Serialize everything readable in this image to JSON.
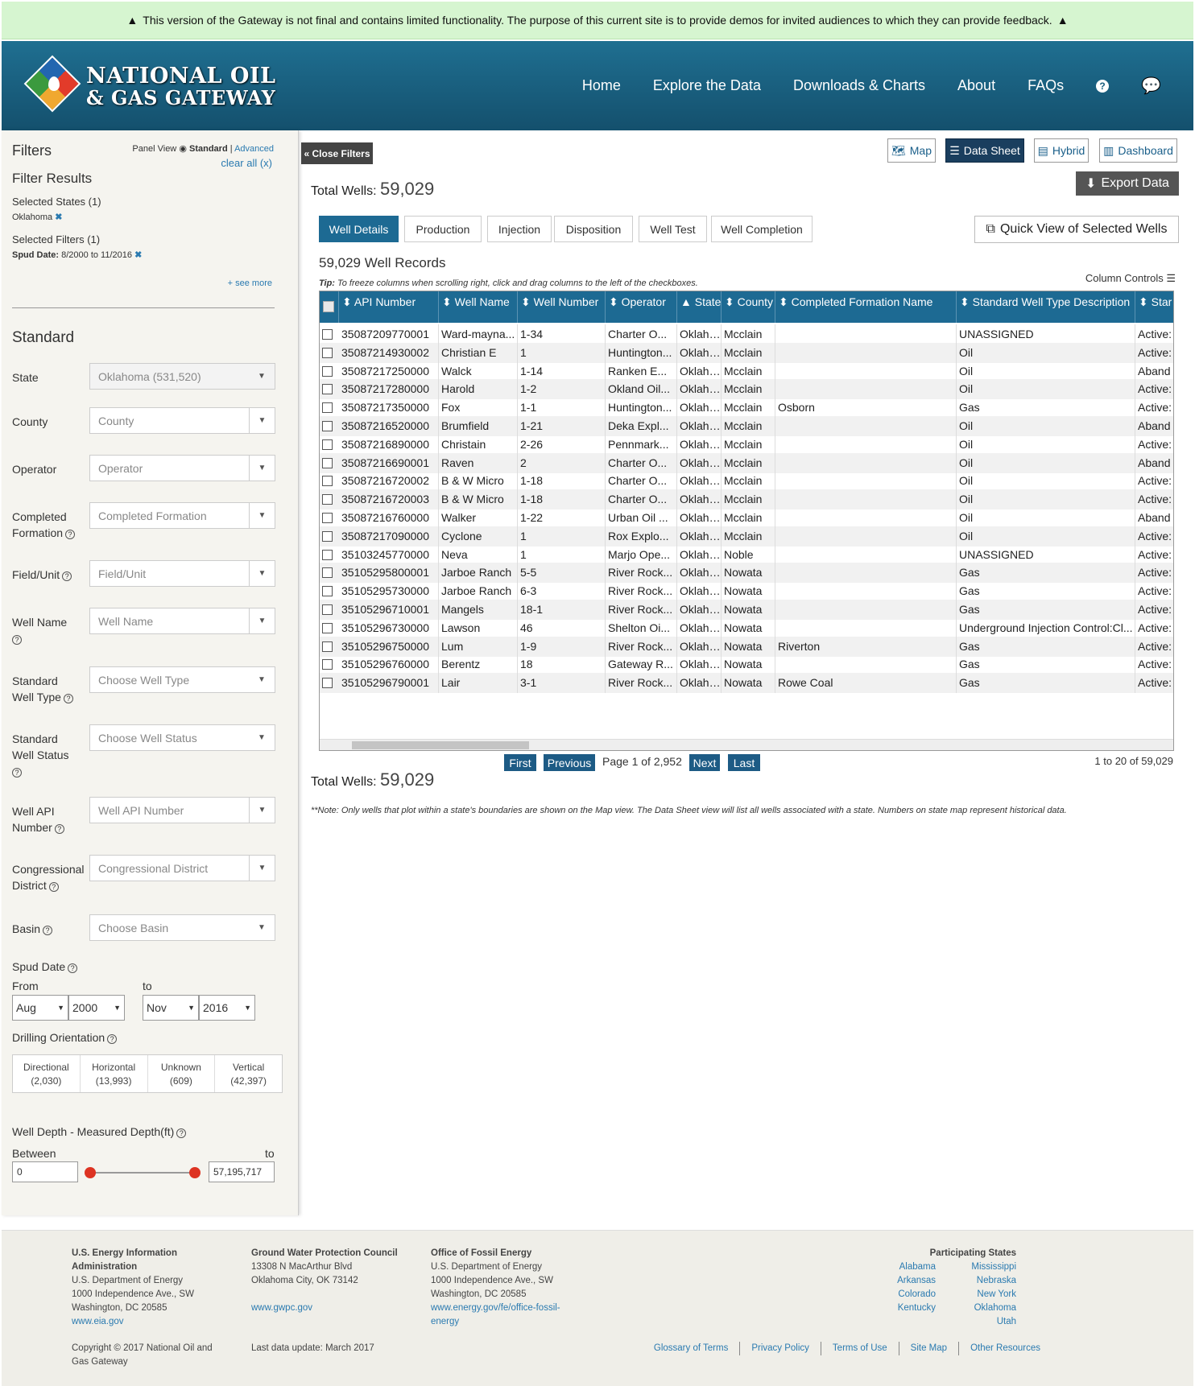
{
  "banner": {
    "text": "This version of the Gateway is not final and contains limited functionality. The purpose of this current site is to provide demos for invited audiences to which they can provide feedback."
  },
  "header": {
    "logo_line1": "NATIONAL OIL",
    "logo_line2": "& GAS GATEWAY",
    "nav": [
      "Home",
      "Explore the Data",
      "Downloads & Charts",
      "About",
      "FAQs"
    ]
  },
  "sidebar": {
    "filters_title": "Filters",
    "panel_view": "Panel View",
    "standard": "Standard",
    "advanced": "Advanced",
    "clear_all": "clear all (x)",
    "filter_results": "Filter Results",
    "selected_states": "Selected States (1)",
    "state_value": "Oklahoma",
    "selected_filters": "Selected Filters (1)",
    "spud_label": "Spud Date:",
    "spud_value": "8/2000 to 11/2016",
    "see_more": "+ see more",
    "standard_heading": "Standard",
    "fields": [
      {
        "label": "State",
        "value": "Oklahoma (531,520)"
      },
      {
        "label": "County",
        "value": "County"
      },
      {
        "label": "Operator",
        "value": "Operator"
      },
      {
        "label": "Completed Formation",
        "value": "Completed Formation"
      },
      {
        "label": "Field/Unit",
        "value": "Field/Unit"
      },
      {
        "label": "Well Name",
        "value": "Well Name"
      },
      {
        "label": "Standard Well Type",
        "value": "Choose Well Type"
      },
      {
        "label": "Standard Well Status",
        "value": "Choose Well Status"
      },
      {
        "label": "Well API Number",
        "value": "Well API Number"
      },
      {
        "label": "Congressional District",
        "value": "Congressional District"
      },
      {
        "label": "Basin",
        "value": "Choose Basin"
      }
    ],
    "spud_date": "Spud Date",
    "from": "From",
    "to": "to",
    "from_month": "Aug",
    "from_year": "2000",
    "to_month": "Nov",
    "to_year": "2016",
    "drilling_orientation": "Drilling Orientation",
    "orientations": [
      {
        "name": "Directional",
        "count": "(2,030)"
      },
      {
        "name": "Horizontal",
        "count": "(13,993)"
      },
      {
        "name": "Unknown",
        "count": "(609)"
      },
      {
        "name": "Vertical",
        "count": "(42,397)"
      }
    ],
    "well_depth": "Well Depth - Measured Depth(ft)",
    "between": "Between",
    "depth_to": "to",
    "depth_min": "0",
    "depth_max": "57,195,717"
  },
  "main": {
    "close_filters": "« Close Filters",
    "views": [
      "Map",
      "Data Sheet",
      "Hybrid",
      "Dashboard"
    ],
    "total_label": "Total Wells:",
    "total_value": "59,029",
    "export": "Export Data",
    "tabs": [
      "Well Details",
      "Production",
      "Injection",
      "Disposition",
      "Well Test",
      "Well Completion"
    ],
    "quick_view": "Quick View of Selected Wells",
    "records": "59,029 Well Records",
    "tip_label": "Tip:",
    "tip": "To freeze columns when scrolling right, click and drag columns to the left of the checkboxes.",
    "column_controls": "Column Controls",
    "columns": [
      "API Number",
      "Well Name",
      "Well Number",
      "Operator",
      "State",
      "County",
      "Completed Formation Name",
      "Standard Well Type Description",
      "Star"
    ],
    "rows": [
      [
        "35087209770001",
        "Ward-mayna...",
        "1-34",
        "Charter O...",
        "Oklaho...",
        "Mcclain",
        "",
        "UNASSIGNED",
        "Active:"
      ],
      [
        "35087214930002",
        "Christian E",
        "1",
        "Huntington...",
        "Oklaho...",
        "Mcclain",
        "",
        "Oil",
        "Active:"
      ],
      [
        "35087217250000",
        "Walck",
        "1-14",
        "Ranken E...",
        "Oklaho...",
        "Mcclain",
        "",
        "Oil",
        "Aband"
      ],
      [
        "35087217280000",
        "Harold",
        "1-2",
        "Okland Oil...",
        "Oklaho...",
        "Mcclain",
        "",
        "Oil",
        "Active:"
      ],
      [
        "35087217350000",
        "Fox",
        "1-1",
        "Huntington...",
        "Oklaho...",
        "Mcclain",
        "Osborn",
        "Gas",
        "Active:"
      ],
      [
        "35087216520000",
        "Brumfield",
        "1-21",
        "Deka Expl...",
        "Oklaho...",
        "Mcclain",
        "",
        "Oil",
        "Aband"
      ],
      [
        "35087216890000",
        "Christain",
        "2-26",
        "Pennmark...",
        "Oklaho...",
        "Mcclain",
        "",
        "Oil",
        "Active:"
      ],
      [
        "35087216690001",
        "Raven",
        "2",
        "Charter O...",
        "Oklaho...",
        "Mcclain",
        "",
        "Oil",
        "Aband"
      ],
      [
        "35087216720002",
        "B & W Micro",
        "1-18",
        "Charter O...",
        "Oklaho...",
        "Mcclain",
        "",
        "Oil",
        "Active:"
      ],
      [
        "35087216720003",
        "B & W Micro",
        "1-18",
        "Charter O...",
        "Oklaho...",
        "Mcclain",
        "",
        "Oil",
        "Active:"
      ],
      [
        "35087216760000",
        "Walker",
        "1-22",
        "Urban Oil ...",
        "Oklaho...",
        "Mcclain",
        "",
        "Oil",
        "Aband"
      ],
      [
        "35087217090000",
        "Cyclone",
        "1",
        "Rox Explo...",
        "Oklaho...",
        "Mcclain",
        "",
        "Oil",
        "Active:"
      ],
      [
        "35103245770000",
        "Neva",
        "1",
        "Marjo Ope...",
        "Oklaho...",
        "Noble",
        "",
        "UNASSIGNED",
        "Active:"
      ],
      [
        "35105295800001",
        "Jarboe Ranch",
        "5-5",
        "River Rock...",
        "Oklaho...",
        "Nowata",
        "",
        "Gas",
        "Active:"
      ],
      [
        "35105295730000",
        "Jarboe Ranch",
        "6-3",
        "River Rock...",
        "Oklaho...",
        "Nowata",
        "",
        "Gas",
        "Active:"
      ],
      [
        "35105296710001",
        "Mangels",
        "18-1",
        "River Rock...",
        "Oklaho...",
        "Nowata",
        "",
        "Gas",
        "Active:"
      ],
      [
        "35105296730000",
        "Lawson",
        "46",
        "Shelton Oi...",
        "Oklaho...",
        "Nowata",
        "",
        "Underground Injection Control:Cl...",
        "Active:"
      ],
      [
        "35105296750000",
        "Lum",
        "1-9",
        "River Rock...",
        "Oklaho...",
        "Nowata",
        "Riverton",
        "Gas",
        "Active:"
      ],
      [
        "35105296760000",
        "Berentz",
        "18",
        "Gateway R...",
        "Oklaho...",
        "Nowata",
        "",
        "Gas",
        "Active:"
      ],
      [
        "35105296790001",
        "Lair",
        "3-1",
        "River Rock...",
        "Oklaho...",
        "Nowata",
        "Rowe Coal",
        "Gas",
        "Active:"
      ]
    ],
    "pager": {
      "first": "First",
      "previous": "Previous",
      "page": "Page 1 of 2,952",
      "next": "Next",
      "last": "Last",
      "range": "1 to 20 of 59,029"
    },
    "note": "**Note: Only wells that plot within a state's boundaries are shown on the Map view. The Data Sheet view will list all wells associated with a state. Numbers on state map represent historical data."
  },
  "footer": {
    "eia": {
      "name1": "U.S. Energy Information",
      "name2": "Administration",
      "l1": "U.S. Department of Energy",
      "l2": "1000 Independence Ave., SW",
      "l3": "Washington, DC 20585",
      "link": "www.eia.gov"
    },
    "gwpc": {
      "name": "Ground Water Protection Council",
      "l1": "13308 N MacArthur Blvd",
      "l2": "Oklahoma City, OK 73142",
      "link": "www.gwpc.gov"
    },
    "ofe": {
      "name": "Office of Fossil Energy",
      "l1": "U.S. Department of Energy",
      "l2": "1000 Independence Ave., SW",
      "l3": "Washington, DC 20585",
      "link1": "www.energy.gov/fe/office-fossil-",
      "link2": "energy"
    },
    "states_title": "Participating States",
    "states": [
      "Alabama",
      "Mississippi",
      "Arkansas",
      "Nebraska",
      "Colorado",
      "New York",
      "Kentucky",
      "Oklahoma",
      "",
      "Utah"
    ],
    "copyright1": "Copyright © 2017 National Oil and",
    "copyright2": "Gas Gateway",
    "last_update": "Last data update: March 2017",
    "links": [
      "Glossary of Terms",
      "Privacy Policy",
      "Terms of Use",
      "Site Map",
      "Other Resources"
    ]
  }
}
